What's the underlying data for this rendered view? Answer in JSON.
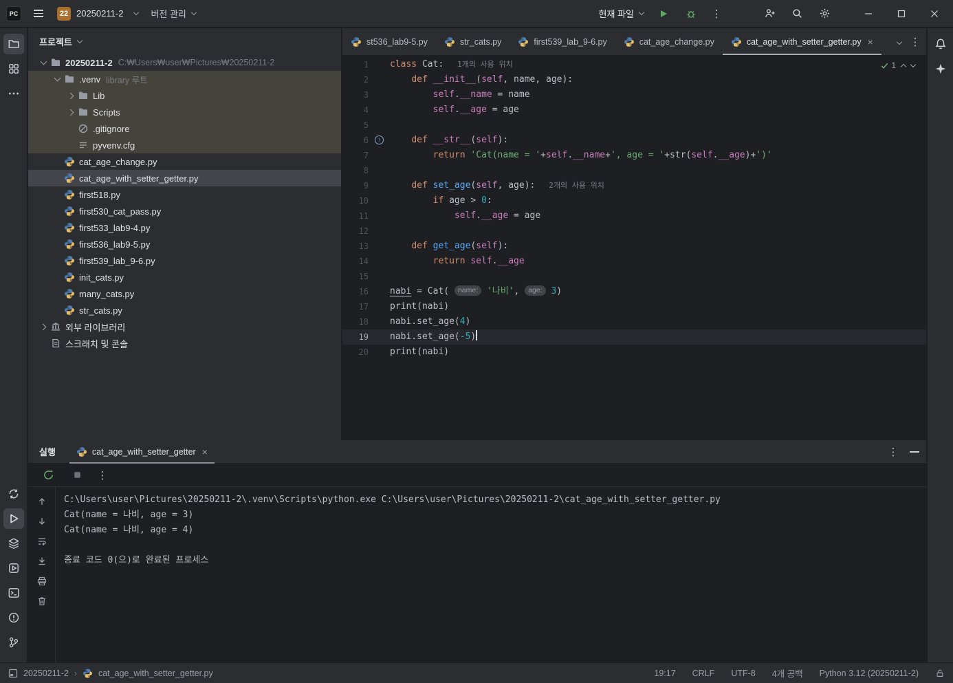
{
  "colors": {
    "panel_bg": "#2b2d30",
    "editor_bg": "#1e1f22",
    "accent_green": "#5fad65",
    "keyword_orange": "#cf8e6d",
    "string_green": "#6aab73",
    "number_teal": "#2aacb8",
    "magic_magenta": "#c77dbb",
    "function_blue": "#56a8f5",
    "tree_highlight_brown": "#45443c",
    "tree_selection_gray": "#43454a",
    "current_line": "#26282e"
  },
  "title_bar": {
    "logo_text": "PC",
    "project_badge": "22",
    "project_name": "20250211-2",
    "vcs_label": "버전 관리",
    "run_config_label": "현재 파일"
  },
  "left_strip": {
    "top_icons": [
      "project",
      "structure",
      "more"
    ],
    "top_active": "project",
    "bottom_icons": [
      "python-console",
      "run",
      "packages",
      "services",
      "terminal",
      "problems",
      "version-control"
    ],
    "bottom_active": "run"
  },
  "right_strip": {
    "icons": [
      "notifications",
      "ai-assistant"
    ]
  },
  "project_panel": {
    "title": "프로젝트",
    "tree": [
      {
        "depth": 0,
        "chevron": "down",
        "icon": "folder",
        "label": "20250211-2",
        "hint": "C:₩Users₩user₩Pictures₩20250211-2",
        "bold": true
      },
      {
        "depth": 1,
        "chevron": "down",
        "icon": "folder",
        "label": ".venv",
        "hint": "library 루트",
        "brown": true
      },
      {
        "depth": 2,
        "chevron": "right",
        "icon": "folder",
        "label": "Lib",
        "brown": true
      },
      {
        "depth": 2,
        "chevron": "right",
        "icon": "folder",
        "label": "Scripts",
        "brown": true
      },
      {
        "depth": 2,
        "icon": "gitignore",
        "label": ".gitignore",
        "brown": true
      },
      {
        "depth": 2,
        "icon": "config",
        "label": "pyvenv.cfg",
        "brown": true
      },
      {
        "depth": 1,
        "icon": "python",
        "label": "cat_age_change.py"
      },
      {
        "depth": 1,
        "icon": "python",
        "label": "cat_age_with_setter_getter.py",
        "selected": true
      },
      {
        "depth": 1,
        "icon": "python",
        "label": "first518.py"
      },
      {
        "depth": 1,
        "icon": "python",
        "label": "first530_cat_pass.py"
      },
      {
        "depth": 1,
        "icon": "python",
        "label": "first533_lab9-4.py"
      },
      {
        "depth": 1,
        "icon": "python",
        "label": "first536_lab9-5.py"
      },
      {
        "depth": 1,
        "icon": "python",
        "label": "first539_lab_9-6.py"
      },
      {
        "depth": 1,
        "icon": "python",
        "label": "init_cats.py"
      },
      {
        "depth": 1,
        "icon": "python",
        "label": "many_cats.py"
      },
      {
        "depth": 1,
        "icon": "python",
        "label": "str_cats.py"
      },
      {
        "depth": 0,
        "chevron": "right",
        "icon": "library",
        "label": "외부 라이브러리"
      },
      {
        "depth": 0,
        "icon": "scratch",
        "label": "스크래치 및 콘솔"
      }
    ]
  },
  "editor": {
    "tabs": [
      {
        "label": "st536_lab9-5.py"
      },
      {
        "label": "str_cats.py"
      },
      {
        "label": "first539_lab_9-6.py"
      },
      {
        "label": "cat_age_change.py"
      },
      {
        "label": "cat_age_with_setter_getter.py",
        "active": true,
        "closable": true
      }
    ],
    "inspection_count": "1",
    "lines": [
      {
        "num": 1,
        "tokens": [
          {
            "c": "kw",
            "t": "class"
          },
          {
            "c": "plain",
            "t": " Cat:"
          },
          {
            "c": "hint",
            "t": "   1개의 사용 위치"
          }
        ]
      },
      {
        "num": 2,
        "tokens": [
          {
            "c": "plain",
            "t": "    "
          },
          {
            "c": "kw",
            "t": "def"
          },
          {
            "c": "plain",
            "t": " "
          },
          {
            "c": "magic",
            "t": "__init__"
          },
          {
            "c": "plain",
            "t": "("
          },
          {
            "c": "self",
            "t": "self"
          },
          {
            "c": "plain",
            "t": ", name, age):"
          }
        ]
      },
      {
        "num": 3,
        "tokens": [
          {
            "c": "plain",
            "t": "        "
          },
          {
            "c": "self",
            "t": "self"
          },
          {
            "c": "plain",
            "t": "."
          },
          {
            "c": "attr",
            "t": "__name"
          },
          {
            "c": "plain",
            "t": " = name"
          }
        ]
      },
      {
        "num": 4,
        "tokens": [
          {
            "c": "plain",
            "t": "        "
          },
          {
            "c": "self",
            "t": "self"
          },
          {
            "c": "plain",
            "t": "."
          },
          {
            "c": "attr",
            "t": "__age"
          },
          {
            "c": "plain",
            "t": " = age"
          }
        ]
      },
      {
        "num": 5,
        "tokens": []
      },
      {
        "num": 6,
        "gutter": "override",
        "tokens": [
          {
            "c": "plain",
            "t": "    "
          },
          {
            "c": "kw",
            "t": "def"
          },
          {
            "c": "plain",
            "t": " "
          },
          {
            "c": "magic",
            "t": "__str__"
          },
          {
            "c": "plain",
            "t": "("
          },
          {
            "c": "self",
            "t": "self"
          },
          {
            "c": "plain",
            "t": "):"
          }
        ]
      },
      {
        "num": 7,
        "tokens": [
          {
            "c": "plain",
            "t": "        "
          },
          {
            "c": "kw",
            "t": "return"
          },
          {
            "c": "plain",
            "t": " "
          },
          {
            "c": "str",
            "t": "'Cat(name = '"
          },
          {
            "c": "plain",
            "t": "+"
          },
          {
            "c": "self",
            "t": "self"
          },
          {
            "c": "plain",
            "t": "."
          },
          {
            "c": "attr",
            "t": "__name"
          },
          {
            "c": "plain",
            "t": "+"
          },
          {
            "c": "str",
            "t": "', age = '"
          },
          {
            "c": "plain",
            "t": "+str("
          },
          {
            "c": "self",
            "t": "self"
          },
          {
            "c": "plain",
            "t": "."
          },
          {
            "c": "attr",
            "t": "__age"
          },
          {
            "c": "plain",
            "t": ")+"
          },
          {
            "c": "str",
            "t": "')'"
          }
        ]
      },
      {
        "num": 8,
        "tokens": []
      },
      {
        "num": 9,
        "tokens": [
          {
            "c": "plain",
            "t": "    "
          },
          {
            "c": "kw",
            "t": "def"
          },
          {
            "c": "plain",
            "t": " "
          },
          {
            "c": "fn",
            "t": "set_age"
          },
          {
            "c": "plain",
            "t": "("
          },
          {
            "c": "self",
            "t": "self"
          },
          {
            "c": "plain",
            "t": ", age):"
          },
          {
            "c": "hint",
            "t": "   2개의 사용 위치"
          }
        ]
      },
      {
        "num": 10,
        "tokens": [
          {
            "c": "plain",
            "t": "        "
          },
          {
            "c": "kw",
            "t": "if"
          },
          {
            "c": "plain",
            "t": " age > "
          },
          {
            "c": "num",
            "t": "0"
          },
          {
            "c": "plain",
            "t": ":"
          }
        ]
      },
      {
        "num": 11,
        "tokens": [
          {
            "c": "plain",
            "t": "            "
          },
          {
            "c": "self",
            "t": "self"
          },
          {
            "c": "plain",
            "t": "."
          },
          {
            "c": "attr",
            "t": "__age"
          },
          {
            "c": "plain",
            "t": " = age"
          }
        ]
      },
      {
        "num": 12,
        "tokens": []
      },
      {
        "num": 13,
        "tokens": [
          {
            "c": "plain",
            "t": "    "
          },
          {
            "c": "kw",
            "t": "def"
          },
          {
            "c": "plain",
            "t": " "
          },
          {
            "c": "fn",
            "t": "get_age"
          },
          {
            "c": "plain",
            "t": "("
          },
          {
            "c": "self",
            "t": "self"
          },
          {
            "c": "plain",
            "t": "):"
          }
        ]
      },
      {
        "num": 14,
        "tokens": [
          {
            "c": "plain",
            "t": "        "
          },
          {
            "c": "kw",
            "t": "return"
          },
          {
            "c": "plain",
            "t": " "
          },
          {
            "c": "self",
            "t": "self"
          },
          {
            "c": "plain",
            "t": "."
          },
          {
            "c": "attr",
            "t": "__age"
          }
        ]
      },
      {
        "num": 15,
        "tokens": []
      },
      {
        "num": 16,
        "tokens": [
          {
            "c": "und",
            "t": "nabi"
          },
          {
            "c": "plain",
            "t": " = Cat( "
          },
          {
            "c": "chip",
            "t": "name:"
          },
          {
            "c": "plain",
            "t": " "
          },
          {
            "c": "str",
            "t": "'나비'"
          },
          {
            "c": "plain",
            "t": ", "
          },
          {
            "c": "chip",
            "t": "age:"
          },
          {
            "c": "plain",
            "t": " "
          },
          {
            "c": "num",
            "t": "3"
          },
          {
            "c": "plain",
            "t": ")"
          }
        ]
      },
      {
        "num": 17,
        "tokens": [
          {
            "c": "plain",
            "t": "print(nabi)"
          }
        ]
      },
      {
        "num": 18,
        "tokens": [
          {
            "c": "plain",
            "t": "nabi.set_age("
          },
          {
            "c": "num",
            "t": "4"
          },
          {
            "c": "plain",
            "t": ")"
          }
        ]
      },
      {
        "num": 19,
        "current": true,
        "caret": true,
        "tokens": [
          {
            "c": "plain",
            "t": "nabi.set_age("
          },
          {
            "c": "num",
            "t": "-5"
          },
          {
            "c": "plain",
            "t": ")"
          }
        ]
      },
      {
        "num": 20,
        "tokens": [
          {
            "c": "plain",
            "t": "print(nabi)"
          }
        ]
      }
    ]
  },
  "run_panel": {
    "title": "실행",
    "tab_label": "cat_age_with_setter_getter",
    "toolbar_icons": [
      "rerun",
      "stop",
      "options"
    ],
    "strip_icons": [
      "up",
      "down",
      "soft-wrap",
      "scroll-end",
      "print",
      "clear"
    ],
    "console_lines": [
      "C:\\Users\\user\\Pictures\\20250211-2\\.venv\\Scripts\\python.exe C:\\Users\\user\\Pictures\\20250211-2\\cat_age_with_setter_getter.py",
      "Cat(name = 나비, age = 3)",
      "Cat(name = 나비, age = 4)",
      "",
      "종료 코드 0(으)로 완료된 프로세스"
    ]
  },
  "status_bar": {
    "project": "20250211-2",
    "file": "cat_age_with_setter_getter.py",
    "caret": "19:17",
    "line_ending": "CRLF",
    "encoding": "UTF-8",
    "indent": "4개 공백",
    "interpreter": "Python 3.12 (20250211-2)"
  }
}
